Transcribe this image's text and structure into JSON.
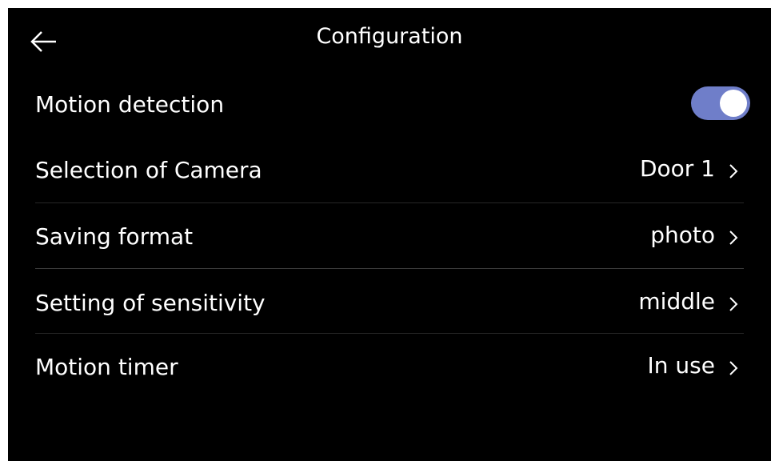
{
  "header": {
    "title": "Configuration",
    "back_icon": "back-arrow-icon"
  },
  "settings": [
    {
      "label": "Motion detection",
      "control": "toggle",
      "toggle_on": true
    },
    {
      "label": "Selection of Camera",
      "value": "Door 1"
    },
    {
      "label": "Saving format",
      "value": "photo"
    },
    {
      "label": "Setting of sensitivity",
      "value": "middle"
    },
    {
      "label": "Motion timer",
      "value": "In use"
    }
  ],
  "colors": {
    "background": "#000000",
    "toggle_on": "#6f7ec9",
    "text": "#ffffff"
  }
}
